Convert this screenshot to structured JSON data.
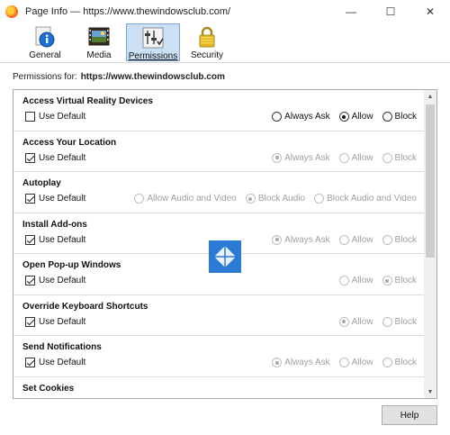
{
  "window": {
    "title": "Page Info — https://www.thewindowsclub.com/",
    "controls": {
      "minimize": "—",
      "maximize": "☐",
      "close": "✕"
    }
  },
  "toolbar": {
    "tabs": [
      {
        "label": "General",
        "icon": "info-icon"
      },
      {
        "label": "Media",
        "icon": "media-icon"
      },
      {
        "label": "Permissions",
        "icon": "permissions-icon",
        "selected": true
      },
      {
        "label": "Security",
        "icon": "lock-icon"
      }
    ]
  },
  "permissions_for": {
    "label": "Permissions for:",
    "site": "https://www.thewindowsclub.com"
  },
  "permissions": [
    {
      "title": "Access Virtual Reality Devices",
      "use_default": "Use Default",
      "use_default_checked": false,
      "options": [
        {
          "label": "Always Ask",
          "on": false,
          "disabled": false
        },
        {
          "label": "Allow",
          "on": true,
          "disabled": false
        },
        {
          "label": "Block",
          "on": false,
          "disabled": false
        }
      ]
    },
    {
      "title": "Access Your Location",
      "use_default": "Use Default",
      "use_default_checked": true,
      "options": [
        {
          "label": "Always Ask",
          "on": true,
          "disabled": true
        },
        {
          "label": "Allow",
          "on": false,
          "disabled": true
        },
        {
          "label": "Block",
          "on": false,
          "disabled": true
        }
      ]
    },
    {
      "title": "Autoplay",
      "use_default": "Use Default",
      "use_default_checked": true,
      "options": [
        {
          "label": "Allow Audio and Video",
          "on": false,
          "disabled": true
        },
        {
          "label": "Block Audio",
          "on": true,
          "disabled": true
        },
        {
          "label": "Block Audio and Video",
          "on": false,
          "disabled": true
        }
      ]
    },
    {
      "title": "Install Add-ons",
      "use_default": "Use Default",
      "use_default_checked": true,
      "options": [
        {
          "label": "Always Ask",
          "on": true,
          "disabled": true
        },
        {
          "label": "Allow",
          "on": false,
          "disabled": true
        },
        {
          "label": "Block",
          "on": false,
          "disabled": true
        }
      ]
    },
    {
      "title": "Open Pop-up Windows",
      "use_default": "Use Default",
      "use_default_checked": true,
      "options": [
        {
          "label": "Allow",
          "on": false,
          "disabled": true
        },
        {
          "label": "Block",
          "on": true,
          "disabled": true
        }
      ]
    },
    {
      "title": "Override Keyboard Shortcuts",
      "use_default": "Use Default",
      "use_default_checked": true,
      "options": [
        {
          "label": "Allow",
          "on": true,
          "disabled": true
        },
        {
          "label": "Block",
          "on": false,
          "disabled": true
        }
      ]
    },
    {
      "title": "Send Notifications",
      "use_default": "Use Default",
      "use_default_checked": true,
      "options": [
        {
          "label": "Always Ask",
          "on": true,
          "disabled": true
        },
        {
          "label": "Allow",
          "on": false,
          "disabled": true
        },
        {
          "label": "Block",
          "on": false,
          "disabled": true
        }
      ]
    },
    {
      "title": "Set Cookies",
      "use_default": "",
      "use_default_checked": false,
      "options": []
    }
  ],
  "help_button": "Help",
  "colors": {
    "selected_tab_bg": "#cce0f5",
    "selected_tab_border": "#7aa7d9",
    "watermark": "#2b7bd4"
  }
}
